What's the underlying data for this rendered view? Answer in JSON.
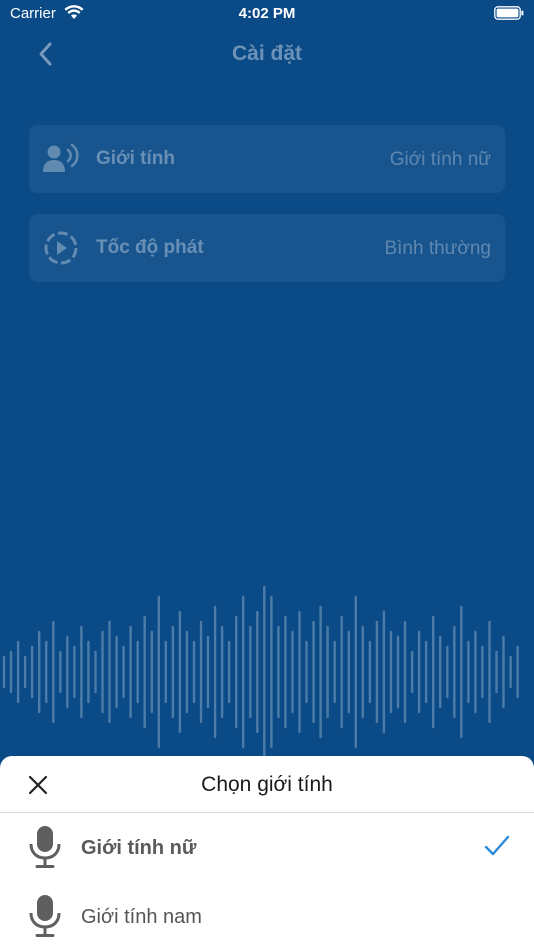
{
  "status_bar": {
    "carrier": "Carrier",
    "time": "4:02 PM",
    "wifi_icon": "wifi-icon",
    "battery_icon": "battery-icon"
  },
  "nav": {
    "title": "Cài đặt",
    "back_icon": "chevron-left-icon"
  },
  "settings": [
    {
      "id": "gender",
      "icon": "speaker-person-icon",
      "label": "Giới tính",
      "value": "Giới tính nữ"
    },
    {
      "id": "speed",
      "icon": "play-circle-icon",
      "label": "Tốc độ phát",
      "value": "Bình thường"
    }
  ],
  "sheet": {
    "title": "Chọn giới tính",
    "close_icon": "close-icon",
    "options": [
      {
        "label": "Giới tính nữ",
        "selected": true,
        "icon": "microphone-icon"
      },
      {
        "label": "Giới tính nam",
        "selected": false,
        "icon": "microphone-icon"
      }
    ]
  },
  "colors": {
    "background": "#0a4a87",
    "accent": "#2b8ad8",
    "sheet": "#ffffff"
  }
}
